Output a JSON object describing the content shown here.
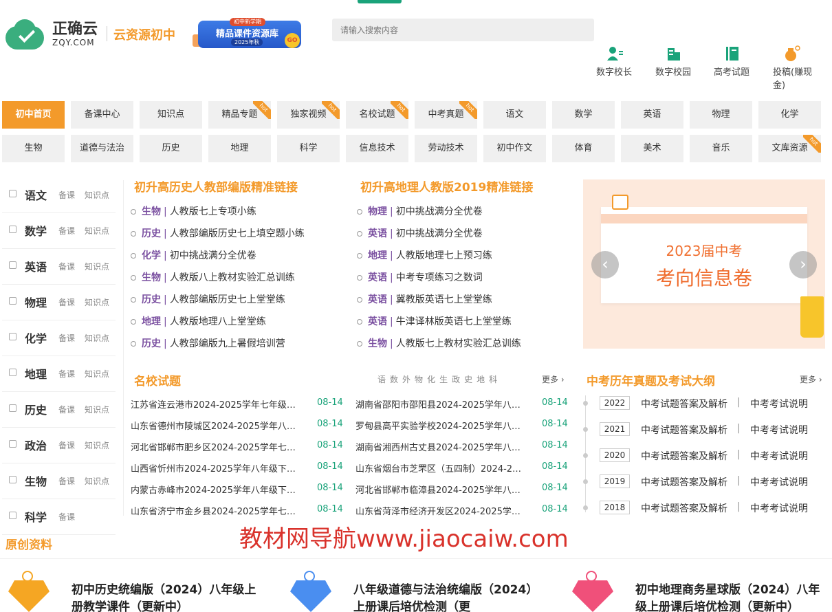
{
  "header": {
    "brand": "正确云",
    "domain": "ZQY.COM",
    "sub_brand": "云资源初中",
    "banner": {
      "tag": "初中新学期",
      "title": "精品课件资源库",
      "year": "2025年秋",
      "go": "GO"
    },
    "search_placeholder": "请输入搜索内容",
    "tools": [
      {
        "label": "数字校长",
        "icon": "principal-icon"
      },
      {
        "label": "数字校园",
        "icon": "campus-icon"
      },
      {
        "label": "高考试题",
        "icon": "exam-book-icon"
      },
      {
        "label": "投稿(赚现金)",
        "icon": "money-bag-icon"
      }
    ]
  },
  "nav": {
    "row1": [
      {
        "label": "初中首页",
        "active": true
      },
      {
        "label": "备课中心"
      },
      {
        "label": "知识点"
      },
      {
        "label": "精品专题",
        "hot": true
      },
      {
        "label": "独家视频",
        "hot": true
      },
      {
        "label": "名校试题",
        "hot": true
      },
      {
        "label": "中考真题",
        "hot": true
      },
      {
        "label": "语文"
      },
      {
        "label": "数学"
      },
      {
        "label": "英语"
      },
      {
        "label": "物理"
      },
      {
        "label": "化学"
      }
    ],
    "row2": [
      {
        "label": "生物"
      },
      {
        "label": "道德与法治"
      },
      {
        "label": "历史"
      },
      {
        "label": "地理"
      },
      {
        "label": "科学"
      },
      {
        "label": "信息技术"
      },
      {
        "label": "劳动技术"
      },
      {
        "label": "初中作文"
      },
      {
        "label": "体育"
      },
      {
        "label": "美术"
      },
      {
        "label": "音乐"
      },
      {
        "label": "文库资源",
        "hot": true
      }
    ],
    "hot_label": "hot"
  },
  "subjects": [
    {
      "name": "语文",
      "l1": "备课",
      "l2": "知识点"
    },
    {
      "name": "数学",
      "l1": "备课",
      "l2": "知识点"
    },
    {
      "name": "英语",
      "l1": "备课",
      "l2": "知识点"
    },
    {
      "name": "物理",
      "l1": "备课",
      "l2": "知识点"
    },
    {
      "name": "化学",
      "l1": "备课",
      "l2": "知识点"
    },
    {
      "name": "地理",
      "l1": "备课",
      "l2": "知识点"
    },
    {
      "name": "历史",
      "l1": "备课",
      "l2": "知识点"
    },
    {
      "name": "政治",
      "l1": "备课",
      "l2": "知识点"
    },
    {
      "name": "生物",
      "l1": "备课",
      "l2": "知识点"
    },
    {
      "name": "科学",
      "l1": "备课",
      "l2": ""
    }
  ],
  "links": {
    "col1_title": "初升高历史人教部编版精准链接",
    "col2_title": "初升高地理人教版2019精准链接",
    "col1": [
      {
        "subj": "生物",
        "text": "人教版七上专项小练"
      },
      {
        "subj": "历史",
        "text": "人教部编版历史七上填空题小练"
      },
      {
        "subj": "化学",
        "text": "初中挑战满分全优卷"
      },
      {
        "subj": "生物",
        "text": "人教版八上教材实验汇总训练"
      },
      {
        "subj": "历史",
        "text": "人教部编版历史七上堂堂练"
      },
      {
        "subj": "地理",
        "text": "人教版地理八上堂堂练"
      },
      {
        "subj": "历史",
        "text": "人教部编版九上暑假培训营"
      }
    ],
    "col2": [
      {
        "subj": "物理",
        "text": "初中挑战满分全优卷"
      },
      {
        "subj": "英语",
        "text": "初中挑战满分全优卷"
      },
      {
        "subj": "地理",
        "text": "人教版地理七上预习练"
      },
      {
        "subj": "英语",
        "text": "中考专项练习之数词"
      },
      {
        "subj": "英语",
        "text": "冀教版英语七上堂堂练"
      },
      {
        "subj": "英语",
        "text": "牛津译林版英语七上堂堂练"
      },
      {
        "subj": "生物",
        "text": "人教版七上教材实验汇总训练"
      }
    ]
  },
  "carousel": {
    "line1": "2023届中考",
    "line2": "考向信息卷",
    "prev": "‹",
    "next": "›"
  },
  "school_exams": {
    "title": "名校试题",
    "filters": [
      "语",
      "数",
      "外",
      "物",
      "化",
      "生",
      "政",
      "史",
      "地",
      "科"
    ],
    "more": "更多",
    "left": [
      {
        "title": "江苏省连云港市2024-2025学年七年级…",
        "date": "08-14"
      },
      {
        "title": "山东省德州市陵城区2024-2025学年八…",
        "date": "08-14"
      },
      {
        "title": "河北省邯郸市肥乡区2024-2025学年七…",
        "date": "08-14"
      },
      {
        "title": "山西省忻州市2024-2025学年八年级下…",
        "date": "08-14"
      },
      {
        "title": "内蒙古赤峰市2024-2025学年八年级下…",
        "date": "08-14"
      },
      {
        "title": "山东省济宁市金乡县2024-2025学年七…",
        "date": "08-14"
      }
    ],
    "right": [
      {
        "title": "湖南省邵阳市邵阳县2024-2025学年八…",
        "date": "08-14"
      },
      {
        "title": "罗甸县高平实验学校2024-2025学年八…",
        "date": "08-14"
      },
      {
        "title": "湖南省湘西州古丈县2024-2025学年八…",
        "date": "08-14"
      },
      {
        "title": "山东省烟台市芝罘区（五四制）2024-2…",
        "date": "08-14"
      },
      {
        "title": "河北省邯郸市临漳县2024-2025学年八…",
        "date": "08-14"
      },
      {
        "title": "山东省菏泽市经济开发区2024-2025学…",
        "date": "08-14"
      }
    ]
  },
  "zhongkao": {
    "title": "中考历年真题及考试大纲",
    "more": "更多",
    "rows": [
      {
        "year": "2022",
        "a": "中考试题答案及解析",
        "sep": "|",
        "b": "中考考试说明"
      },
      {
        "year": "2021",
        "a": "中考试题答案及解析",
        "sep": "|",
        "b": "中考考试说明"
      },
      {
        "year": "2020",
        "a": "中考试题答案及解析",
        "sep": "|",
        "b": "中考考试说明"
      },
      {
        "year": "2019",
        "a": "中考试题答案及解析",
        "sep": "|",
        "b": "中考考试说明"
      },
      {
        "year": "2018",
        "a": "中考试题答案及解析",
        "sep": "|",
        "b": "中考考试说明"
      }
    ]
  },
  "original": {
    "title": "原创资料",
    "items": [
      {
        "text": "初中历史统编版（2024）八年级上册教学课件（更新中）",
        "color": "#f5a623"
      },
      {
        "text": "八年级道德与法治统编版（2024）上册课后培优检测（更",
        "color": "#4a8ef0"
      },
      {
        "text": "初中地理商务星球版（2024）八年级上册课后培优检测（更新中）",
        "color": "#f0507a"
      }
    ]
  },
  "watermark": "教材网导航www.jiaocaiw.com"
}
